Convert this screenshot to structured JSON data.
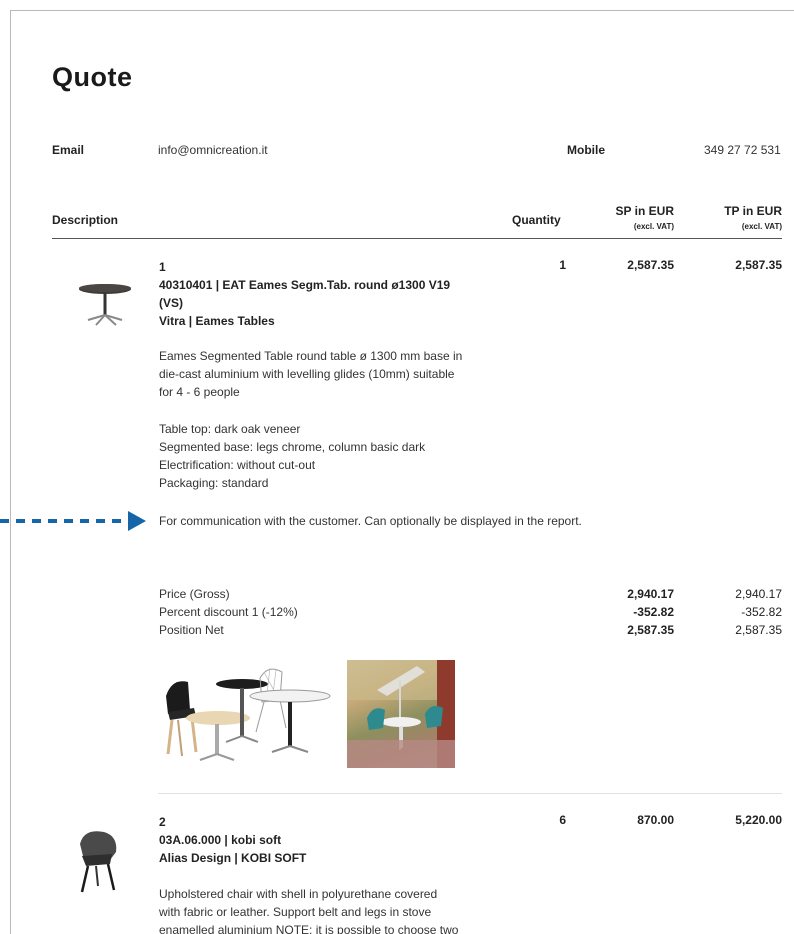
{
  "title": "Quote",
  "contact": {
    "email_label": "Email",
    "email_value": "info@omnicreation.it",
    "mobile_label": "Mobile",
    "mobile_value": "349 27 72 531"
  },
  "table_header": {
    "description": "Description",
    "quantity": "Quantity",
    "sp_label": "SP in EUR",
    "sp_sub": "(excl. VAT)",
    "tp_label": "TP in EUR",
    "tp_sub": "(excl. VAT)"
  },
  "items": [
    {
      "index": "1",
      "code_line1": "40310401 | EAT Eames Segm.Tab. round ø1300 V19",
      "code_line2": "(VS)",
      "brand": "Vitra | Eames Tables",
      "quantity": "1",
      "sp": "2,587.35",
      "tp": "2,587.35",
      "desc_lines": [
        "Eames Segmented Table round table ø 1300 mm base in",
        "die-cast aluminium with levelling glides (10mm) suitable",
        "for 4 - 6 people"
      ],
      "option_lines": [
        "Table top: dark oak veneer",
        "Segmented base: legs chrome, column basic dark",
        "Electrification: without cut-out",
        "Packaging: standard"
      ],
      "note": "For communication with the customer. Can optionally be displayed in the report.",
      "price_rows": [
        {
          "label": "Price (Gross)",
          "sp": "2,940.17",
          "tp": "2,940.17"
        },
        {
          "label": "Percent discount 1 (-12%)",
          "sp": "-352.82",
          "tp": "-352.82"
        },
        {
          "label": "Position Net",
          "sp": "2,587.35",
          "tp": "2,587.35"
        }
      ]
    },
    {
      "index": "2",
      "code_line1": "03A.06.000 | kobi soft",
      "brand": "Alias Design | KOBI SOFT",
      "quantity": "6",
      "sp": "870.00",
      "tp": "5,220.00",
      "desc_lines": [
        "Upholstered chair with shell in polyurethane covered",
        "with fabric or leather. Support belt and legs in stove",
        "enamelled aluminium NOTE: it is possible to choose two"
      ]
    }
  ],
  "colors": {
    "arrow": "#1565a8"
  }
}
